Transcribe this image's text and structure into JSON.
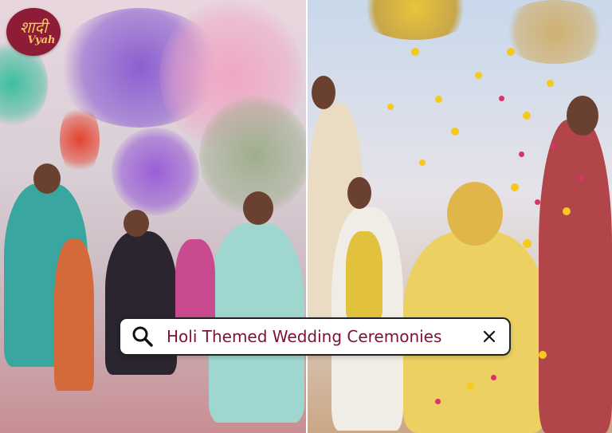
{
  "brand": {
    "logo_line1": "शादी",
    "logo_line2": "Vyah",
    "color": "#8e1c36",
    "text_color": "#f2c660"
  },
  "search": {
    "query": "Holi Themed Wedding Ceremonies",
    "search_icon": "search-icon",
    "clear_icon": "close-icon",
    "text_color": "#7a1430"
  },
  "images": {
    "left_photo": "holi-color-smoke-dance-photo",
    "right_photo": "bride-marigold-petal-shower-photo"
  }
}
